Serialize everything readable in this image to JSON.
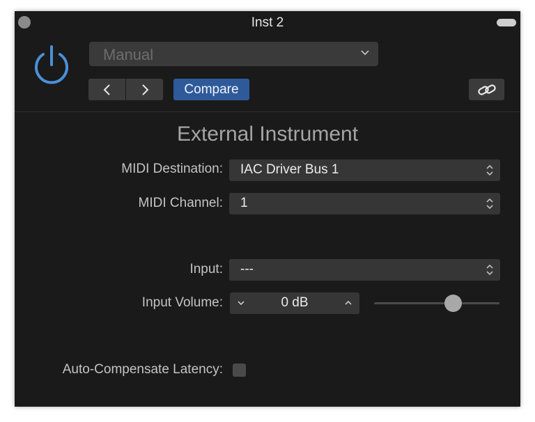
{
  "window": {
    "title": "Inst 2"
  },
  "header": {
    "preset_value": "Manual",
    "compare_label": "Compare"
  },
  "plugin": {
    "title": "External Instrument",
    "midi_destination": {
      "label": "MIDI Destination:",
      "value": "IAC Driver Bus 1"
    },
    "midi_channel": {
      "label": "MIDI Channel:",
      "value": "1"
    },
    "input": {
      "label": "Input:",
      "value": "---"
    },
    "input_volume": {
      "label": "Input Volume:",
      "value": "0 dB",
      "slider_level": 0.63
    },
    "auto_compensate_latency": {
      "label": "Auto-Compensate Latency:",
      "checked": false
    }
  },
  "icons": {
    "power": "power-icon",
    "prev": "chevron-left-icon",
    "next": "chevron-right-icon",
    "link": "link-icon",
    "dropdown": "chevron-down-icon",
    "updown": "updown-arrows-icon"
  },
  "colors": {
    "accent": "#4a90d9",
    "compare_bg": "#2f5a9a",
    "window_bg": "#1a1a1a"
  }
}
